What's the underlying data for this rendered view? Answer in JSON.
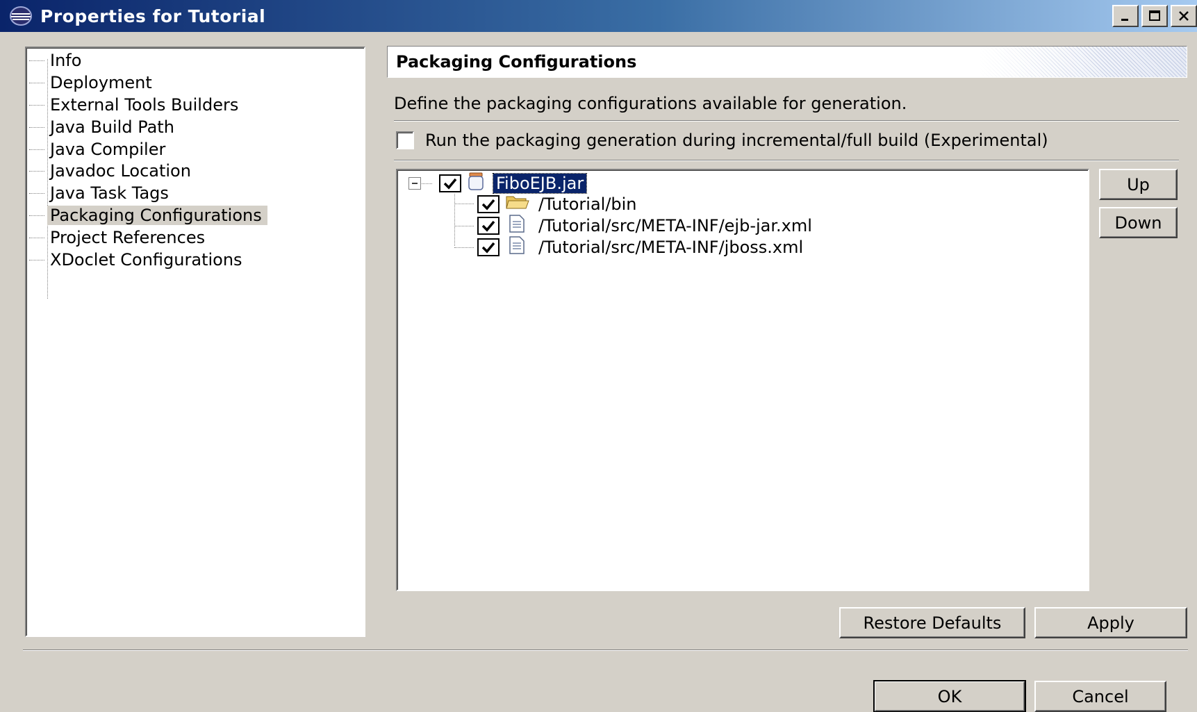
{
  "window": {
    "title": "Properties for Tutorial"
  },
  "sidebar": {
    "items": [
      {
        "label": "Info"
      },
      {
        "label": "Deployment"
      },
      {
        "label": "External Tools Builders"
      },
      {
        "label": "Java Build Path"
      },
      {
        "label": "Java Compiler"
      },
      {
        "label": "Javadoc Location"
      },
      {
        "label": "Java Task Tags"
      },
      {
        "label": "Packaging Configurations",
        "selected": true
      },
      {
        "label": "Project References"
      },
      {
        "label": "XDoclet Configurations"
      }
    ]
  },
  "page": {
    "title": "Packaging Configurations",
    "description": "Define the packaging configurations available for generation.",
    "incremental_label": "Run the packaging generation during incremental/full build (Experimental)",
    "incremental_checked": false
  },
  "tree": {
    "root": {
      "label": "FiboEJB.jar",
      "checked": true,
      "icon": "jar-icon"
    },
    "children": [
      {
        "label": "/Tutorial/bin",
        "checked": true,
        "icon": "folder-icon"
      },
      {
        "label": "/Tutorial/src/META-INF/ejb-jar.xml",
        "checked": true,
        "icon": "file-icon"
      },
      {
        "label": "/Tutorial/src/META-INF/jboss.xml",
        "checked": true,
        "icon": "file-icon"
      }
    ]
  },
  "buttons": {
    "up": "Up",
    "down": "Down",
    "restore_defaults": "Restore Defaults",
    "apply": "Apply",
    "ok": "OK",
    "cancel": "Cancel"
  },
  "colors": {
    "title_bar": "#0a246a",
    "dialog_bg": "#d4d0c8",
    "selection": "#0a246a"
  }
}
